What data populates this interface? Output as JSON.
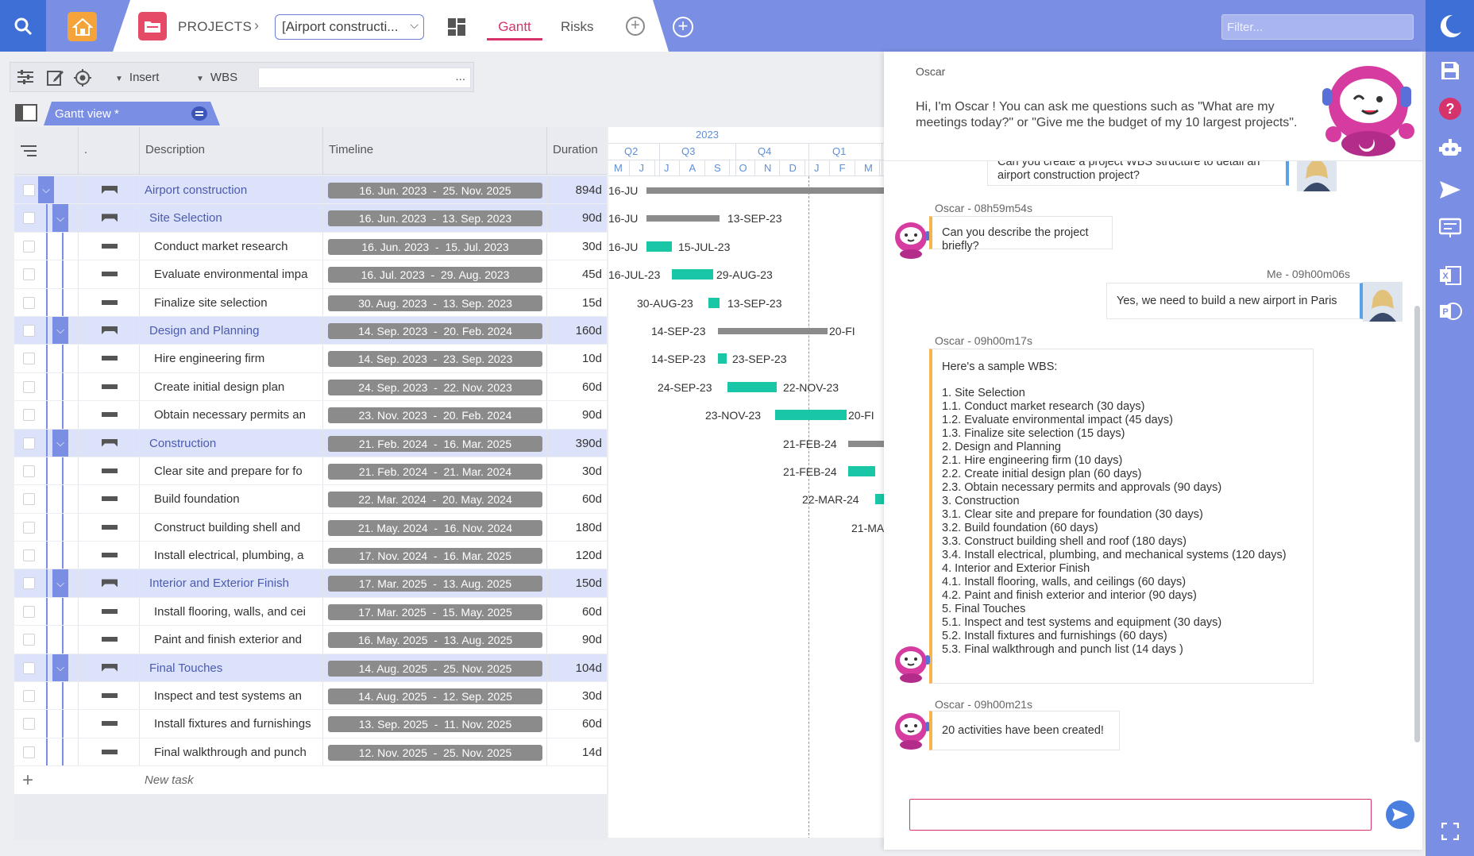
{
  "topbar": {
    "projects_label": "PROJECTS",
    "project_select_value": "[Airport constructi...",
    "tabs": [
      {
        "label": "Gantt",
        "active": true
      },
      {
        "label": "Risks",
        "active": false
      }
    ],
    "filter_placeholder": "Filter..."
  },
  "toolbar": {
    "insert_label": "Insert",
    "wbs_label": "WBS",
    "field_dots": "..."
  },
  "view": {
    "tab_label": "Gantt view *"
  },
  "grid": {
    "columns": {
      "dot": ".",
      "description": "Description",
      "timeline": "Timeline",
      "duration": "Duration"
    },
    "rows": [
      {
        "desc": "Airport construction",
        "timeline": "16. Jun. 2023  -  25. Nov. 2025",
        "duration": "894d",
        "group": true,
        "level": 0
      },
      {
        "desc": "Site Selection",
        "timeline": "16. Jun. 2023  -  13. Sep. 2023",
        "duration": "90d",
        "group": true,
        "level": 1
      },
      {
        "desc": "Conduct market research",
        "timeline": "16. Jun. 2023  -  15. Jul. 2023",
        "duration": "30d",
        "group": false,
        "level": 2
      },
      {
        "desc": "Evaluate environmental impa",
        "timeline": "16. Jul. 2023  -  29. Aug. 2023",
        "duration": "45d",
        "group": false,
        "level": 2
      },
      {
        "desc": "Finalize site selection",
        "timeline": "30. Aug. 2023  -  13. Sep. 2023",
        "duration": "15d",
        "group": false,
        "level": 2
      },
      {
        "desc": "Design and Planning",
        "timeline": "14. Sep. 2023  -  20. Feb. 2024",
        "duration": "160d",
        "group": true,
        "level": 1
      },
      {
        "desc": "Hire engineering firm",
        "timeline": "14. Sep. 2023  -  23. Sep. 2023",
        "duration": "10d",
        "group": false,
        "level": 2
      },
      {
        "desc": "Create initial design plan",
        "timeline": "24. Sep. 2023  -  22. Nov. 2023",
        "duration": "60d",
        "group": false,
        "level": 2
      },
      {
        "desc": "Obtain necessary permits an",
        "timeline": "23. Nov. 2023  -  20. Feb. 2024",
        "duration": "90d",
        "group": false,
        "level": 2
      },
      {
        "desc": "Construction",
        "timeline": "21. Feb. 2024  -  16. Mar. 2025",
        "duration": "390d",
        "group": true,
        "level": 1
      },
      {
        "desc": "Clear site and prepare for fo",
        "timeline": "21. Feb. 2024  -  21. Mar. 2024",
        "duration": "30d",
        "group": false,
        "level": 2
      },
      {
        "desc": "Build foundation",
        "timeline": "22. Mar. 2024  -  20. May. 2024",
        "duration": "60d",
        "group": false,
        "level": 2
      },
      {
        "desc": "Construct building shell and",
        "timeline": "21. May. 2024  -  16. Nov. 2024",
        "duration": "180d",
        "group": false,
        "level": 2
      },
      {
        "desc": "Install electrical, plumbing, a",
        "timeline": "17. Nov. 2024  -  16. Mar. 2025",
        "duration": "120d",
        "group": false,
        "level": 2
      },
      {
        "desc": "Interior and Exterior Finish",
        "timeline": "17. Mar. 2025  -  13. Aug. 2025",
        "duration": "150d",
        "group": true,
        "level": 1
      },
      {
        "desc": "Install flooring, walls, and cei",
        "timeline": "17. Mar. 2025  -  15. May. 2025",
        "duration": "60d",
        "group": false,
        "level": 2
      },
      {
        "desc": "Paint and finish exterior and",
        "timeline": "16. May. 2025  -  13. Aug. 2025",
        "duration": "90d",
        "group": false,
        "level": 2
      },
      {
        "desc": "Final Touches",
        "timeline": "14. Aug. 2025  -  25. Nov. 2025",
        "duration": "104d",
        "group": true,
        "level": 1
      },
      {
        "desc": "Inspect and test systems an",
        "timeline": "14. Aug. 2025  -  12. Sep. 2025",
        "duration": "30d",
        "group": false,
        "level": 2
      },
      {
        "desc": "Install fixtures and furnishings",
        "timeline": "13. Sep. 2025  -  11. Nov. 2025",
        "duration": "60d",
        "group": false,
        "level": 2
      },
      {
        "desc": "Final walkthrough and punch",
        "timeline": "12. Nov. 2025  -  25. Nov. 2025",
        "duration": "14d",
        "group": false,
        "level": 2
      }
    ],
    "new_task_label": "New task"
  },
  "gantt": {
    "year": "2023",
    "quarters": [
      "Q2",
      "Q3",
      "Q4",
      "Q1"
    ],
    "months": [
      "M",
      "J",
      "J",
      "A",
      "S",
      "O",
      "N",
      "D",
      "J",
      "F",
      "M"
    ],
    "labels": [
      {
        "start": "16-JU",
        "end": ""
      },
      {
        "start": "16-JU",
        "end": "13-SEP-23"
      },
      {
        "start": "16-JU",
        "end": "15-JUL-23"
      },
      {
        "start": "16-JUL-23",
        "end": "29-AUG-23"
      },
      {
        "start": "30-AUG-23",
        "end": "13-SEP-23"
      },
      {
        "start": "14-SEP-23",
        "end": "20-FI"
      },
      {
        "start": "14-SEP-23",
        "end": "23-SEP-23"
      },
      {
        "start": "24-SEP-23",
        "end": "22-NOV-23"
      },
      {
        "start": "23-NOV-23",
        "end": "20-FI"
      },
      {
        "start": "21-FEB-24",
        "end": ""
      },
      {
        "start": "21-FEB-24",
        "end": ""
      },
      {
        "start": "22-MAR-24",
        "end": ""
      },
      {
        "start": "21-MA",
        "end": ""
      }
    ]
  },
  "chat": {
    "assistant_name": "Oscar",
    "intro": "Hi, I'm Oscar ! You can ask me questions such as \"What are my meetings today?\" or \"Give me the budget of my 10 largest projects\".",
    "messages": [
      {
        "from": "me",
        "meta": "",
        "text": "Can you create a project WBS structure to detail an airport construction project?"
      },
      {
        "from": "bot",
        "meta": "Oscar - 08h59m54s",
        "text": "Can you describe the project briefly?"
      },
      {
        "from": "me",
        "meta": "Me - 09h00m06s",
        "text": "Yes, we need to build a new airport in Paris"
      },
      {
        "from": "bot",
        "meta": "Oscar - 09h00m17s",
        "intro": "Here's a sample WBS:",
        "lines": [
          "1. Site Selection",
          "1.1. Conduct market research (30 days)",
          "1.2. Evaluate environmental impact (45 days)",
          "1.3. Finalize site selection (15 days)",
          "2. Design and Planning",
          "2.1. Hire engineering firm (10 days)",
          "2.2. Create initial design plan (60 days)",
          "2.3. Obtain necessary permits and approvals (90 days)",
          "3. Construction",
          "3.1. Clear site and prepare for foundation (30 days)",
          "3.2. Build foundation (60 days)",
          "3.3. Construct building shell and roof (180 days)",
          "3.4. Install electrical, plumbing, and mechanical systems (120 days)",
          "4. Interior and Exterior Finish",
          "4.1. Install flooring, walls, and ceilings (60 days)",
          "4.2. Paint and finish exterior and interior (90 days)",
          "5. Final Touches",
          "5.1. Inspect and test systems and equipment (30 days)",
          "5.2. Install fixtures and furnishings (60 days)",
          "5.3. Final walkthrough and punch list (14 days )"
        ]
      },
      {
        "from": "bot",
        "meta": "Oscar - 09h00m21s",
        "text": "20 activities have been created!"
      }
    ],
    "input_value": ""
  },
  "colors": {
    "topbar": "#7a8ee3",
    "accent": "#d6336c",
    "gantt_bar": "#19c6a5",
    "summary_bar": "#8b8b8b"
  }
}
